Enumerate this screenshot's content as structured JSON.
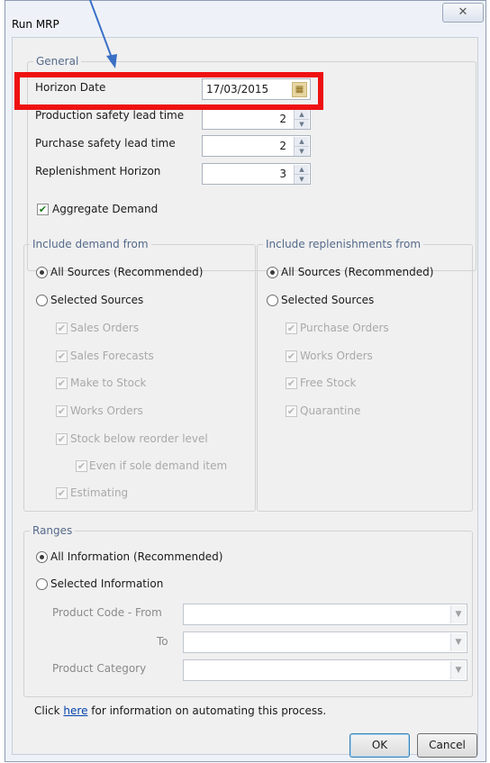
{
  "window": {
    "title": "Run MRP",
    "close_glyph": "✕"
  },
  "general": {
    "legend": "General",
    "horizon_date_label": "Horizon Date",
    "horizon_date_value": "17/03/2015",
    "production_lead_label": "Production safety lead time",
    "production_lead_value": "2",
    "purchase_lead_label": "Purchase safety lead time",
    "purchase_lead_value": "2",
    "replenishment_label": "Replenishment Horizon",
    "replenishment_value": "3",
    "aggregate_label": "Aggregate Demand"
  },
  "demand": {
    "legend": "Include demand from",
    "all_label": "All Sources (Recommended)",
    "selected_label": "Selected Sources",
    "items": [
      "Sales Orders",
      "Sales Forecasts",
      "Make to Stock",
      "Works Orders",
      "Stock below reorder level",
      "Even if sole demand item",
      "Estimating"
    ]
  },
  "replenishment": {
    "legend": "Include replenishments from",
    "all_label": "All Sources (Recommended)",
    "selected_label": "Selected Sources",
    "items": [
      "Purchase Orders",
      "Works Orders",
      "Free Stock",
      "Quarantine"
    ]
  },
  "ranges": {
    "legend": "Ranges",
    "all_label": "All Information (Recommended)",
    "selected_label": "Selected Information",
    "product_code_label": "Product Code -  From",
    "to_label": "To",
    "product_category_label": "Product Category"
  },
  "footer": {
    "info_prefix": "Click ",
    "info_link": "here",
    "info_suffix": " for information on automating this process.",
    "ok_label": "OK",
    "cancel_label": "Cancel"
  },
  "colors": {
    "highlight": "#ee1111",
    "arrow": "#3a6fc6"
  }
}
